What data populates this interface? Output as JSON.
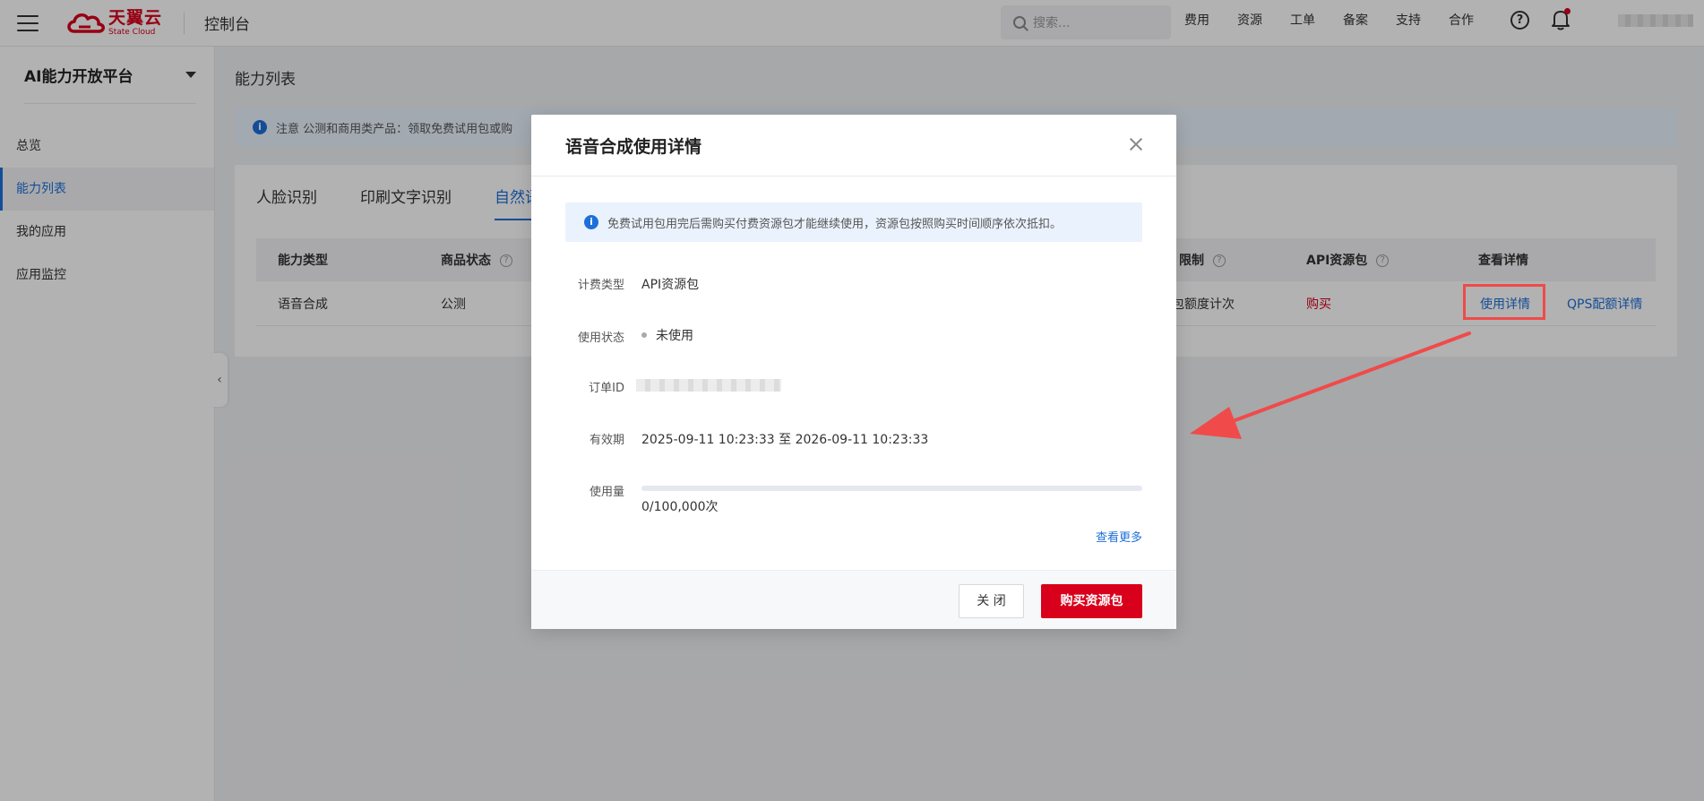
{
  "topbar": {
    "logo_cn": "天翼云",
    "logo_en": "State Cloud",
    "console_title": "控制台",
    "search_placeholder": "搜索...",
    "nav": [
      "费用",
      "资源",
      "工单",
      "备案",
      "支持",
      "合作"
    ],
    "help_icon": "question-circle-icon",
    "bell_icon": "bell-icon"
  },
  "sidebar": {
    "platform": "AI能力开放平台",
    "items": [
      {
        "label": "总览"
      },
      {
        "label": "能力列表"
      },
      {
        "label": "我的应用"
      },
      {
        "label": "应用监控"
      }
    ],
    "collapse_glyph": "‹"
  },
  "main": {
    "page_title": "能力列表",
    "notice": "注意 公测和商用类产品：领取免费试用包或购",
    "tabs": [
      "人脸识别",
      "印刷文字识别",
      "自然语"
    ],
    "table": {
      "headers": {
        "type": "能力类型",
        "status": "商品状态",
        "limit": "限制",
        "api_pack": "API资源包",
        "details": "查看详情"
      },
      "row": {
        "type": "语音合成",
        "status": "公测",
        "limit": "包额度计次",
        "api_pack": "购买",
        "detail_link": "使用详情",
        "qps_link": "QPS配额详情"
      }
    }
  },
  "modal": {
    "title": "语音合成使用详情",
    "tip": "免费试用包用完后需购买付费资源包才能继续使用，资源包按照购买时间顺序依次抵扣。",
    "fields": {
      "billing_label": "计费类型",
      "billing_value": "API资源包",
      "status_label": "使用状态",
      "status_value": "未使用",
      "order_label": "订单ID",
      "validity_label": "有效期",
      "validity_value": "2025-09-11 10:23:33 至 2026-09-11 10:23:33",
      "usage_label": "使用量",
      "usage_value": "0/100,000次",
      "usage_fraction": 0
    },
    "see_more": "查看更多",
    "close_button": "关 闭",
    "buy_button": "购买资源包"
  },
  "colors": {
    "brand_red": "#d8001b",
    "link_blue": "#1e6fd9",
    "annotation_red": "#f04a4a"
  }
}
